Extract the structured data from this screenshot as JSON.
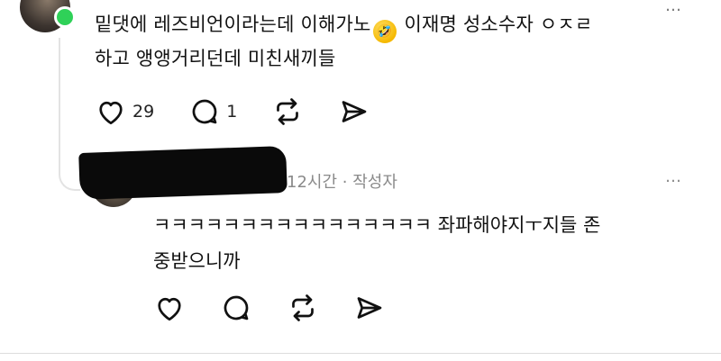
{
  "comment1": {
    "line1": "밑댓에 레즈비언이라는데 이해가노",
    "emoji": "🤣",
    "line1_tail": "이재명 성소수자 ㅇㅈㄹ",
    "line2": "하고 앵앵거리던데 미친새끼들",
    "likes": "29",
    "replies": "1",
    "more_icon": "…"
  },
  "reply": {
    "time": "12시간",
    "separator": "·",
    "author_tag": "작성자",
    "line1": "ㅋㅋㅋㅋㅋㅋㅋㅋㅋㅋㅋㅋㅋㅋㅋㅋ 좌파해야지ㅜ지들 존",
    "line2": "중받으니까",
    "more_icon": "…"
  },
  "colors": {
    "online": "#2fd158",
    "meta": "#8a8a8a",
    "icon": "#111111"
  },
  "icons": [
    "heart-icon",
    "comment-icon",
    "repost-icon",
    "share-icon"
  ]
}
